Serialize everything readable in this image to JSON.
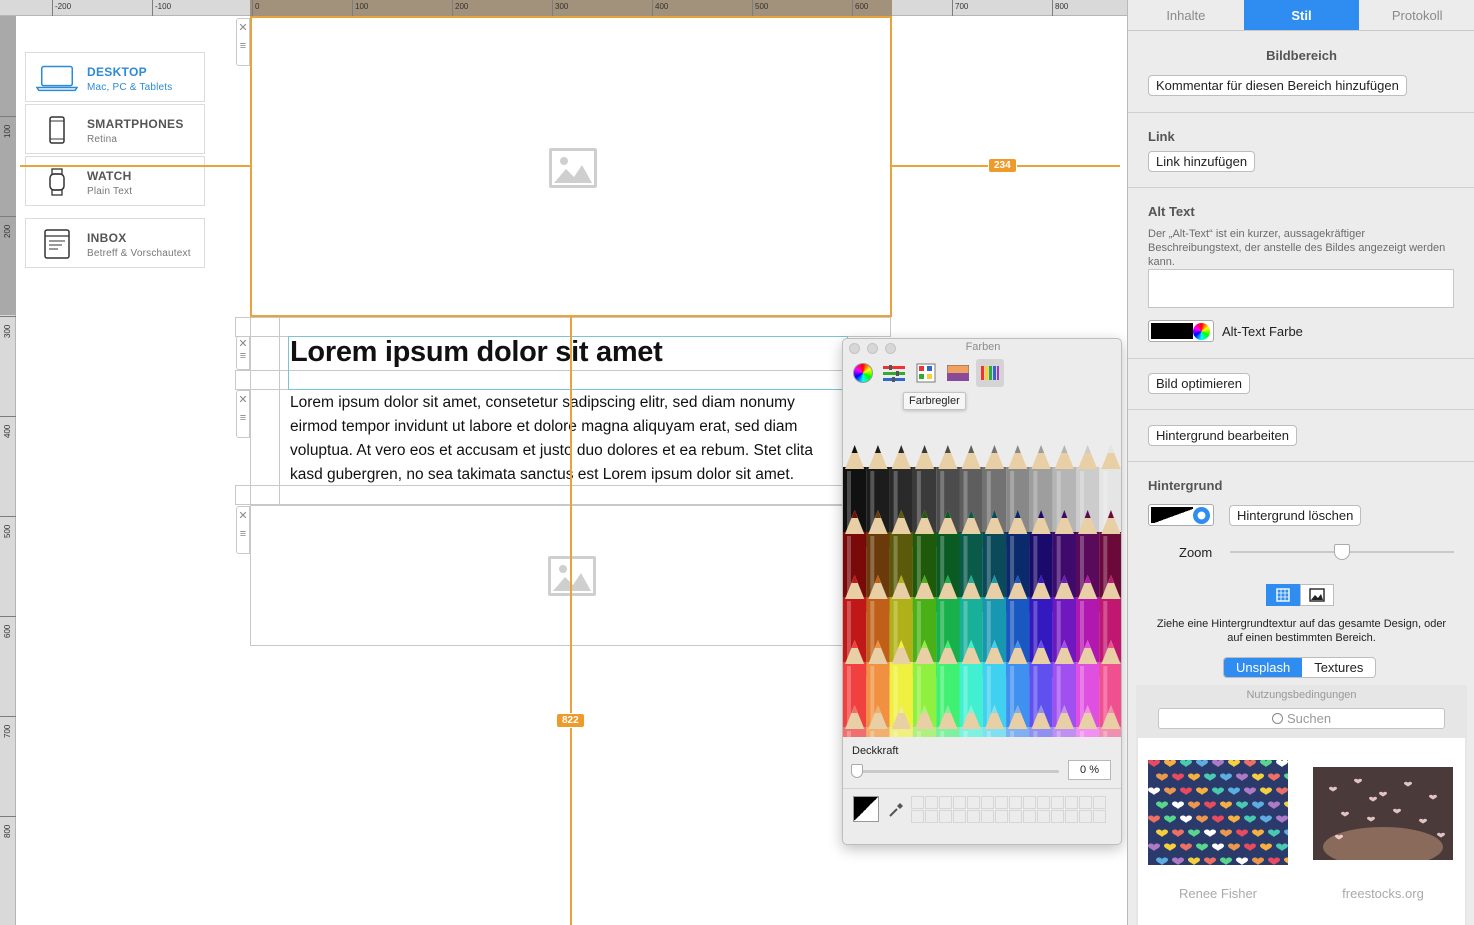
{
  "canvas": {
    "ruler_top_labels": [
      "-200",
      "-100",
      "0",
      "100",
      "200",
      "300",
      "400",
      "500",
      "600",
      "700",
      "800"
    ],
    "ruler_left_labels": [
      "100",
      "200",
      "300",
      "400",
      "500",
      "600",
      "700",
      "800"
    ],
    "devices": [
      {
        "name": "DESKTOP",
        "sub": "Mac, PC & Tablets",
        "icon": "laptop-icon",
        "active": true
      },
      {
        "name": "SMARTPHONES",
        "sub": "Retina",
        "icon": "smartphone-icon",
        "active": false
      },
      {
        "name": "WATCH",
        "sub": "Plain Text",
        "icon": "watch-icon",
        "active": false
      },
      {
        "name": "INBOX",
        "sub": "Betreff & Vorschautext",
        "icon": "inbox-icon",
        "active": false
      }
    ],
    "heading": "Lorem ipsum dolor sit amet",
    "paragraph": "Lorem ipsum dolor sit amet, consetetur sadipscing elitr, sed diam nonumy eirmod tempor invidunt ut labore et dolore magna aliquyam erat, sed diam voluptua. At vero eos et accusam et justo duo dolores et ea rebum. Stet clita kasd gubergren, no sea takimata sanctus est Lorem ipsum dolor sit amet.",
    "measure_horizontal": "234",
    "measure_vertical": "822",
    "accent_color": "#e8a33a"
  },
  "colors_panel": {
    "title": "Farben",
    "tools": [
      "color-wheel-icon",
      "sliders-icon",
      "palettes-icon",
      "image-palette-icon",
      "pencils-icon"
    ],
    "tooltip": "Farbregler",
    "opacity_label": "Deckkraft",
    "opacity_value": "0 %",
    "opacity_fraction": 0.0
  },
  "inspector": {
    "tabs": [
      {
        "label": "Inhalte",
        "active": false
      },
      {
        "label": "Stil",
        "active": true
      },
      {
        "label": "Protokoll",
        "active": false
      }
    ],
    "section_title": "Bildbereich",
    "comment_button": "Kommentar für diesen Bereich hinzufügen",
    "link_title": "Link",
    "link_button": "Link hinzufügen",
    "alt_title": "Alt Text",
    "alt_desc": "Der „Alt-Text“ ist ein kurzer, aussagekräftiger Beschreibungstext, der anstelle des Bildes angezeigt werden kann.",
    "alt_color_label": "Alt-Text Farbe",
    "optimize_button": "Bild optimieren",
    "edit_bg_button": "Hintergrund bearbeiten",
    "bg_title": "Hintergrund",
    "delete_bg_button": "Hintergrund löschen",
    "zoom_label": "Zoom",
    "zoom_fraction": 0.5,
    "texture_hint": "Ziehe eine Hintergrundtextur auf das gesamte Design, oder auf einen bestimmten Bereich.",
    "source_tabs": [
      {
        "label": "Unsplash",
        "active": true
      },
      {
        "label": "Textures",
        "active": false
      }
    ],
    "terms": "Nutzungsbedingungen",
    "search_placeholder": "Suchen",
    "photos": [
      {
        "credit": "Renee Fisher"
      },
      {
        "credit": "freestocks.org"
      }
    ],
    "accent_color": "#2f8cf0"
  }
}
